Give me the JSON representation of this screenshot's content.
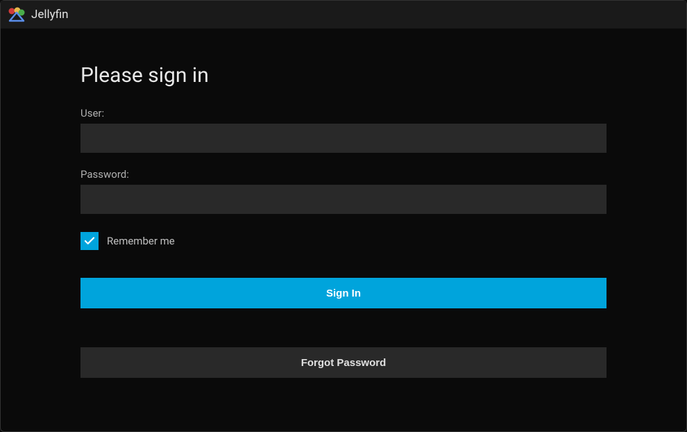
{
  "header": {
    "brand_name": "Jellyfin"
  },
  "login": {
    "title": "Please sign in",
    "user_label": "User:",
    "user_value": "",
    "password_label": "Password:",
    "password_value": "",
    "remember_label": "Remember me",
    "remember_checked": true,
    "signin_label": "Sign In",
    "forgot_label": "Forgot Password"
  },
  "colors": {
    "accent": "#00a4dc",
    "background": "#0a0a0a",
    "surface": "#292929",
    "header": "#1a1a1a"
  }
}
